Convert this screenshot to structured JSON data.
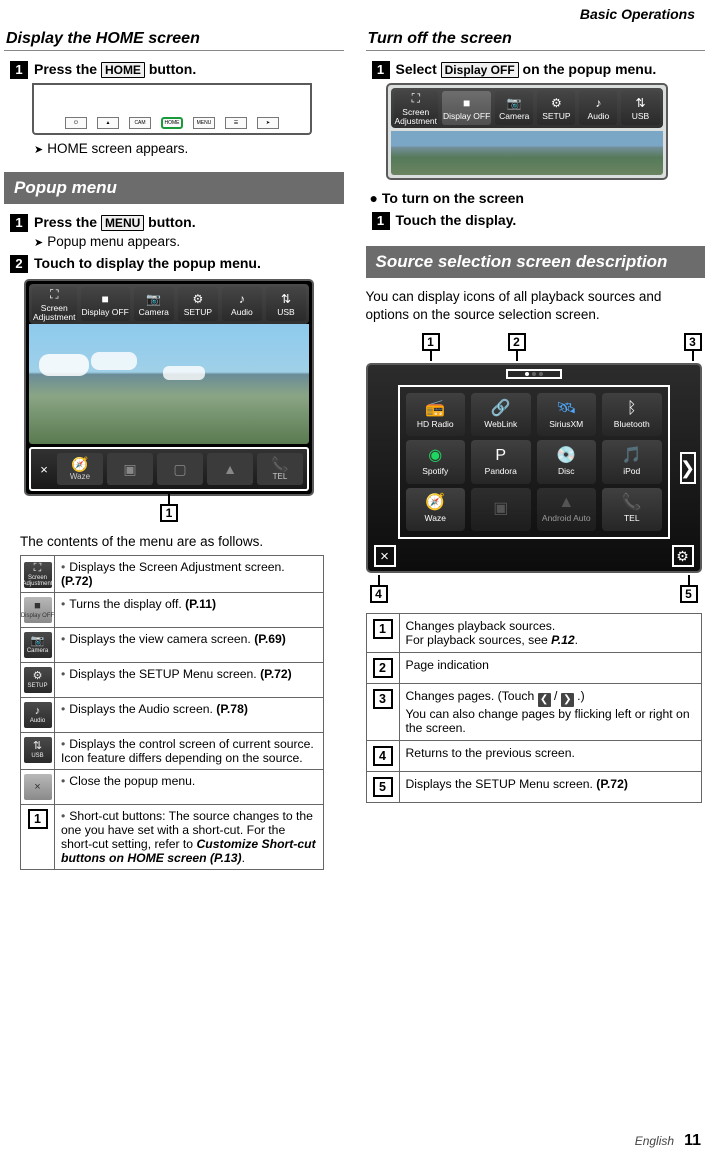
{
  "page_header": "Basic Operations",
  "footer": {
    "lang": "English",
    "page": "11"
  },
  "left": {
    "h_display_home": "Display the HOME screen",
    "step1": {
      "pre": "Press the ",
      "btn": "HOME",
      "post": " button."
    },
    "result1": "HOME screen appears.",
    "panel_buttons": [
      "⏻",
      "▲",
      "CAM",
      "HOME",
      "MENU",
      "☰",
      "➤"
    ],
    "sub_popup": "Popup menu",
    "pm_step1": {
      "pre": "Press the ",
      "btn": "MENU",
      "post": " button."
    },
    "pm_result1": "Popup menu appears.",
    "pm_step2": "Touch to display the popup menu.",
    "popup_items": [
      {
        "ic": "⛶",
        "label": "Screen\nAdjustment"
      },
      {
        "ic": "■",
        "label": "Display OFF"
      },
      {
        "ic": "📷",
        "label": "Camera"
      },
      {
        "ic": "⚙",
        "label": "SETUP"
      },
      {
        "ic": "♪",
        "label": "Audio"
      },
      {
        "ic": "⇅",
        "label": "USB"
      }
    ],
    "shortcut_items": [
      {
        "ic": "🧭",
        "label": "Waze",
        "color": "#4fc8f0"
      },
      {
        "ic": "▣",
        "label": "",
        "color": "#888"
      },
      {
        "ic": "▢",
        "label": "",
        "color": "#888"
      },
      {
        "ic": "▲",
        "label": "",
        "color": "#888"
      },
      {
        "ic": "📞",
        "label": "TEL",
        "color": "#3fb93f"
      }
    ],
    "shortcut_tag": "1",
    "pm_caption": "The contents of the menu are as follows.",
    "table": {
      "rows": [
        {
          "iconType": "mini",
          "ic": "⛶",
          "label": "Screen\nAdjustment",
          "html": "Displays the Screen Adjustment screen. <b>(P.72)</b>"
        },
        {
          "iconType": "mini-light",
          "ic": "■",
          "label": "Display OFF",
          "html": "Turns the display off. <b>(P.11)</b>"
        },
        {
          "iconType": "mini",
          "ic": "📷",
          "label": "Camera",
          "html": "Displays the view camera screen. <b>(P.69)</b>"
        },
        {
          "iconType": "mini",
          "ic": "⚙",
          "label": "SETUP",
          "html": "Displays the SETUP Menu screen. <b>(P.72)</b>"
        },
        {
          "iconType": "mini",
          "ic": "♪",
          "label": "Audio",
          "html": "Displays the Audio screen. <b>(P.78)</b>"
        },
        {
          "iconType": "mini",
          "ic": "⇅",
          "label": "USB",
          "html": "Displays the control screen of current source. Icon feature differs depending on the source."
        },
        {
          "iconType": "mini-light",
          "ic": "×",
          "label": "",
          "html": "Close the popup menu."
        },
        {
          "iconType": "box",
          "boxnum": "1",
          "html": "Short-cut buttons: The source changes to the one you have set with a short-cut. For the short-cut setting, refer to <b><i>Customize Short-cut buttons on HOME screen (P.13)</i></b>."
        }
      ]
    }
  },
  "right": {
    "h_turn_off": "Turn off the screen",
    "t_step1": {
      "pre": "Select ",
      "btn": "Display OFF",
      "post": " on the popup menu."
    },
    "sub_turn_on": "To turn on the screen",
    "ton_step1": "Touch the display.",
    "sub_source_sel": "Source selection screen description",
    "src_body": "You can display icons of all playback sources and options on the source selection screen.",
    "src_tags_top": [
      "1",
      "2",
      "3"
    ],
    "src_tags_bottom": [
      "4",
      "5"
    ],
    "src_grid": [
      [
        {
          "ic": "📻",
          "label": "HD Radio",
          "color": "#f78d1e"
        },
        {
          "ic": "🔗",
          "label": "WebLink",
          "color": "#fff"
        },
        {
          "ic": "🛰",
          "label": "SiriusXM",
          "color": "#4da9ff"
        },
        {
          "ic": "ᛒ",
          "label": "Bluetooth",
          "color": "#fff"
        }
      ],
      [
        {
          "ic": "◉",
          "label": "Spotify",
          "color": "#1ed760"
        },
        {
          "ic": "P",
          "label": "Pandora",
          "color": "#fff"
        },
        {
          "ic": "💿",
          "label": "Disc",
          "color": "#ccc"
        },
        {
          "ic": "🎵",
          "label": "iPod",
          "color": "#ccc"
        }
      ],
      [
        {
          "ic": "🧭",
          "label": "Waze",
          "color": "#4fc8f0"
        },
        {
          "ic": "▣",
          "label": "",
          "dim": true,
          "color": "#888"
        },
        {
          "ic": "▲",
          "label": "Android Auto",
          "dim": true,
          "color": "#888"
        },
        {
          "ic": "📞",
          "label": "TEL",
          "color": "#3fb93f"
        }
      ]
    ],
    "ntable": {
      "rows": [
        {
          "num": "1",
          "html": "Changes playback sources.<br>For playback sources, see <b><i>P.12</i></b>."
        },
        {
          "num": "2",
          "html": "Page indication"
        },
        {
          "num": "3",
          "html": "Changes pages. (Touch <span class='inline-chev'>❮</span> / <span class='inline-chev'>❯</span> .)<br>You can also change pages by flicking left or right on the screen."
        },
        {
          "num": "4",
          "html": "Returns to the previous screen."
        },
        {
          "num": "5",
          "html": "Displays the SETUP Menu screen. <b>(P.72)</b>"
        }
      ]
    }
  }
}
